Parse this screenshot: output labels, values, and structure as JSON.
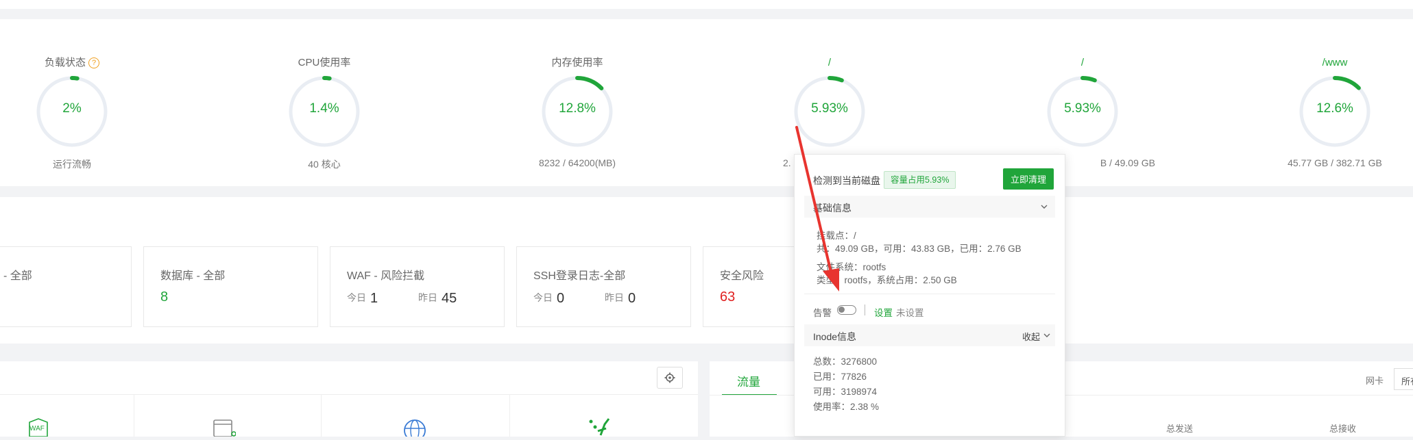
{
  "gauges": [
    {
      "title": "负载状态",
      "value": "2%",
      "percent": 2,
      "sub": "运行流畅",
      "title_green": false,
      "help": "?"
    },
    {
      "title": "CPU使用率",
      "value": "1.4%",
      "percent": 1.4,
      "sub": "40 核心",
      "title_green": false
    },
    {
      "title": "内存使用率",
      "value": "12.8%",
      "percent": 12.8,
      "sub": "8232 / 64200(MB)",
      "title_green": false
    },
    {
      "title": "/",
      "value": "5.93%",
      "percent": 5.93,
      "sub": "2.",
      "title_green": true
    },
    {
      "title": "/",
      "value": "5.93%",
      "percent": 5.93,
      "sub": "B / 49.09 GB",
      "title_green": true
    },
    {
      "title": "/www",
      "value": "12.6%",
      "percent": 12.6,
      "sub": "45.77 GB / 382.71 GB",
      "title_green": true
    }
  ],
  "cards": {
    "c0": {
      "title": "- 全部"
    },
    "c1": {
      "title": "数据库 - 全部",
      "value": "8"
    },
    "c2": {
      "title": "WAF - 风险拦截",
      "today_label": "今日",
      "today": "1",
      "yesterday_label": "昨日",
      "yesterday": "45"
    },
    "c3": {
      "title": "SSH登录日志-全部",
      "today_label": "今日",
      "today": "0",
      "yesterday_label": "昨日",
      "yesterday": "0"
    },
    "c4": {
      "title": "安全风险",
      "value": "63"
    }
  },
  "bottom": {
    "tab_traffic": "流量",
    "nic_label": "网卡",
    "nic_select": "所有",
    "total_sent": "总发送",
    "total_recv": "总接收",
    "waf_icon_text": "WAF"
  },
  "popup": {
    "detected": "检测到当前磁盘",
    "badge": "容量占用5.93%",
    "clean_button": "立即清理",
    "basic_info": "基础信息",
    "mount": "挂载点：/",
    "total_line": "共：49.09 GB，可用：43.83 GB，已用：2.76 GB",
    "fs": "文件系统：rootfs",
    "type": "类型：rootfs，系统占用：2.50 GB",
    "alert": "告警",
    "settings": "设置",
    "unset": "未设置",
    "inode": "Inode信息",
    "collapse": "收起",
    "inode_total": "总数：3276800",
    "inode_used": "已用：77826",
    "inode_free": "可用：3198974",
    "inode_rate": "使用率：2.38 %"
  },
  "colors": {
    "accent": "#20a53a",
    "danger": "#e02020",
    "ring_track": "#e9edf3",
    "arrow": "#e8342f"
  }
}
